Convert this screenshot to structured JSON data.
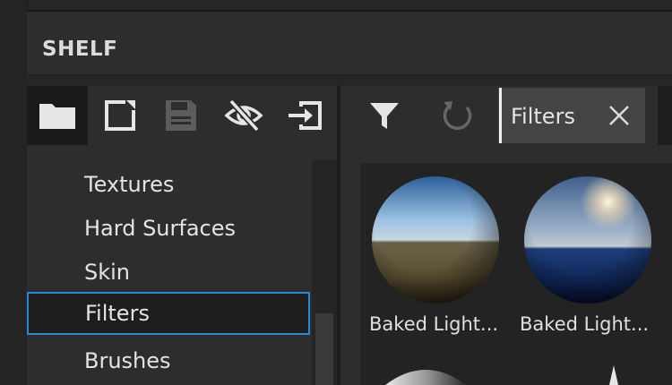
{
  "panel": {
    "title": "SHELF"
  },
  "toolbar_left": {
    "buttons": [
      {
        "icon": "folder-icon",
        "active": true
      },
      {
        "icon": "new-file-icon",
        "active": false
      },
      {
        "icon": "save-icon",
        "active": false,
        "disabled": true
      },
      {
        "icon": "eye-hidden-icon",
        "active": false
      },
      {
        "icon": "import-icon",
        "active": false
      }
    ]
  },
  "toolbar_right": {
    "filter_icon": "filter-icon",
    "reset_icon": "refresh-icon",
    "search": {
      "value": "Filters",
      "clear_icon": "close-icon"
    }
  },
  "categories": [
    {
      "label": "Textures",
      "selected": false
    },
    {
      "label": "Hard Surfaces",
      "selected": false
    },
    {
      "label": "Skin",
      "selected": false
    },
    {
      "label": "Filters",
      "selected": true
    },
    {
      "label": "Brushes",
      "selected": false
    }
  ],
  "assets": [
    {
      "label": "Baked Light..."
    },
    {
      "label": "Baked Light..."
    }
  ],
  "colors": {
    "accent": "#2b86d6",
    "background": "#2d2d2d"
  }
}
